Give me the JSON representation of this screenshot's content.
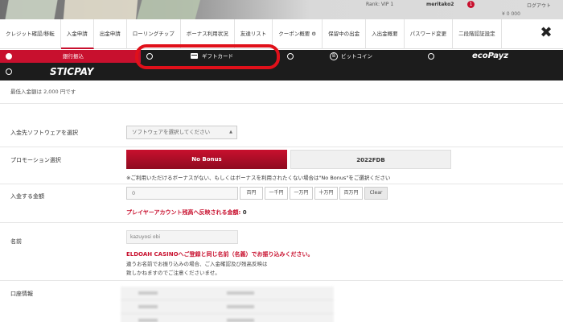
{
  "background": {
    "rank_label": "Rank: VIP 1",
    "username": "meritako2",
    "notification_count": "1",
    "logout_label": "ログアウト",
    "balance": "¥ 0 000"
  },
  "tabs": [
    {
      "label": "クレジット確認/移転"
    },
    {
      "label": "入金申請",
      "active": true
    },
    {
      "label": "出金申請"
    },
    {
      "label": "ローリングチップ"
    },
    {
      "label": "ボーナス利用状況"
    },
    {
      "label": "友達リスト"
    },
    {
      "label": "クーポン概要 ⚙"
    },
    {
      "label": "保留中の出金"
    },
    {
      "label": "入出金概要"
    },
    {
      "label": "パスワード変更"
    },
    {
      "label": "二段階認証設定"
    }
  ],
  "close_label": "✖",
  "methods": {
    "bank": "銀行振込",
    "gift": "ギフトカード",
    "bitcoin": "ビットコイン",
    "bitcoin_icon": "B",
    "ecopayz": "ecoPayz",
    "sticpay": "STICPAY",
    "selected": "bank"
  },
  "form": {
    "min_amount_note": "最低入金額は 2,000 円です",
    "software_label": "入金先ソフトウェアを選択",
    "software_placeholder": "ソフトウェアを選択してください",
    "promotion_label": "プロモーション選択",
    "promo_nobonus": "No Bonus",
    "promo_2022": "2022FDB",
    "promo_note": "※ご利用いただけるボーナスがない、もしくはボーナスを利用されたくない場合は\"No Bonus\"をご選択ください",
    "amount_label": "入金する金額",
    "amount_value": "0",
    "amount_buttons": [
      "百円",
      "一千円",
      "一万円",
      "十万円",
      "百万円",
      "Clear"
    ],
    "reflect_label": "プレイヤーアカウント残高へ反映される金額:",
    "reflect_value": "0",
    "name_label": "名前",
    "name_value": "kazuyosi obi",
    "warning_1": "ELDOAH CASINOへご登録と同じ名前（名義）でお振り込みください。",
    "warning_2": "違うお名前でお振り込みの場合、ご入金確認及び残高反映は",
    "warning_3": "致しかねますのでご注意くださいませ。",
    "account_label": "口座情報"
  }
}
